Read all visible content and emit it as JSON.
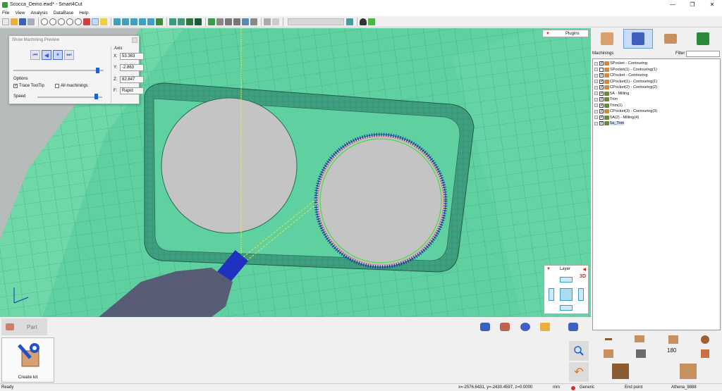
{
  "window": {
    "title": "Scocca_Demo.ewd* - Smart4Cut",
    "minimize": "—",
    "maximize": "❐",
    "close": "✕"
  },
  "menu": [
    "File",
    "View",
    "Analysis",
    "DataBase",
    "Help"
  ],
  "preview_panel": {
    "title": "Show Machining Preview",
    "axis_label": "Axis",
    "x_label": "X:",
    "x_value": "53.363",
    "y_label": "Y:",
    "y_value": "-2.863",
    "z_label": "Z:",
    "z_value": "82.847",
    "f_label": "F:",
    "f_value": "Rapid",
    "options_label": "Options",
    "trace_tooltip_label": "Trace ToolTip",
    "trace_tooltip_checked": true,
    "all_machinings_label": "All machinings",
    "all_machinings_checked": false,
    "speed_label": "Speed",
    "progress_fraction": 0.93,
    "speed_fraction": 0.9
  },
  "viewport": {
    "plugins_label": "Plugins",
    "layer_label": "Layer",
    "layer_mode": "3D",
    "background_color": "#5fd0a0"
  },
  "bottom_panel": {
    "part_tab_label": "Part",
    "create_kit_label": "Create kit",
    "rotate_180_label": "180"
  },
  "right_panel": {
    "machinings_label": "Machinings",
    "filter_label": "Filter",
    "filter_value": "",
    "machinings": [
      {
        "label": "SPocket - Contouring",
        "checked": true,
        "icon_color": "#d08a3a"
      },
      {
        "label": "SPocket(1) - Contouring(1)",
        "checked": false,
        "icon_color": "#d08a3a"
      },
      {
        "label": "CPocket - Contouring",
        "checked": true,
        "icon_color": "#d08a3a"
      },
      {
        "label": "CPocket(1) - Contouring(1)",
        "checked": true,
        "icon_color": "#d08a3a"
      },
      {
        "label": "CPocket(2) - Contouring(2)",
        "checked": true,
        "icon_color": "#d08a3a"
      },
      {
        "label": "5A - Milling",
        "checked": true,
        "icon_color": "#6a8a3a"
      },
      {
        "label": "Trim",
        "checked": true,
        "icon_color": "#6a8a3a"
      },
      {
        "label": "Trim(1)",
        "checked": true,
        "icon_color": "#6a8a3a"
      },
      {
        "label": "CPocket(3) - Contouring(3)",
        "checked": true,
        "icon_color": "#d08a3a"
      },
      {
        "label": "5A(2) - Milling(4)",
        "checked": true,
        "icon_color": "#6a8a3a"
      },
      {
        "label": "5a_Trim",
        "checked": true,
        "icon_color": "#6a8a3a",
        "selected": true
      }
    ]
  },
  "statusbar": {
    "ready": "Ready",
    "coordinates": "x=-2576.6431, y=-2430.4597, z=0.0000",
    "units": "mm",
    "material": "Generic",
    "snap_mode": "End point",
    "machine": "Athena_9888"
  },
  "colors": {
    "accent_blue": "#2060c8",
    "toolpath_green": "#44dd44",
    "toolpath_blue": "#1a2fb0",
    "selection": "#c8dcf8",
    "alert_red": "#c22222"
  }
}
